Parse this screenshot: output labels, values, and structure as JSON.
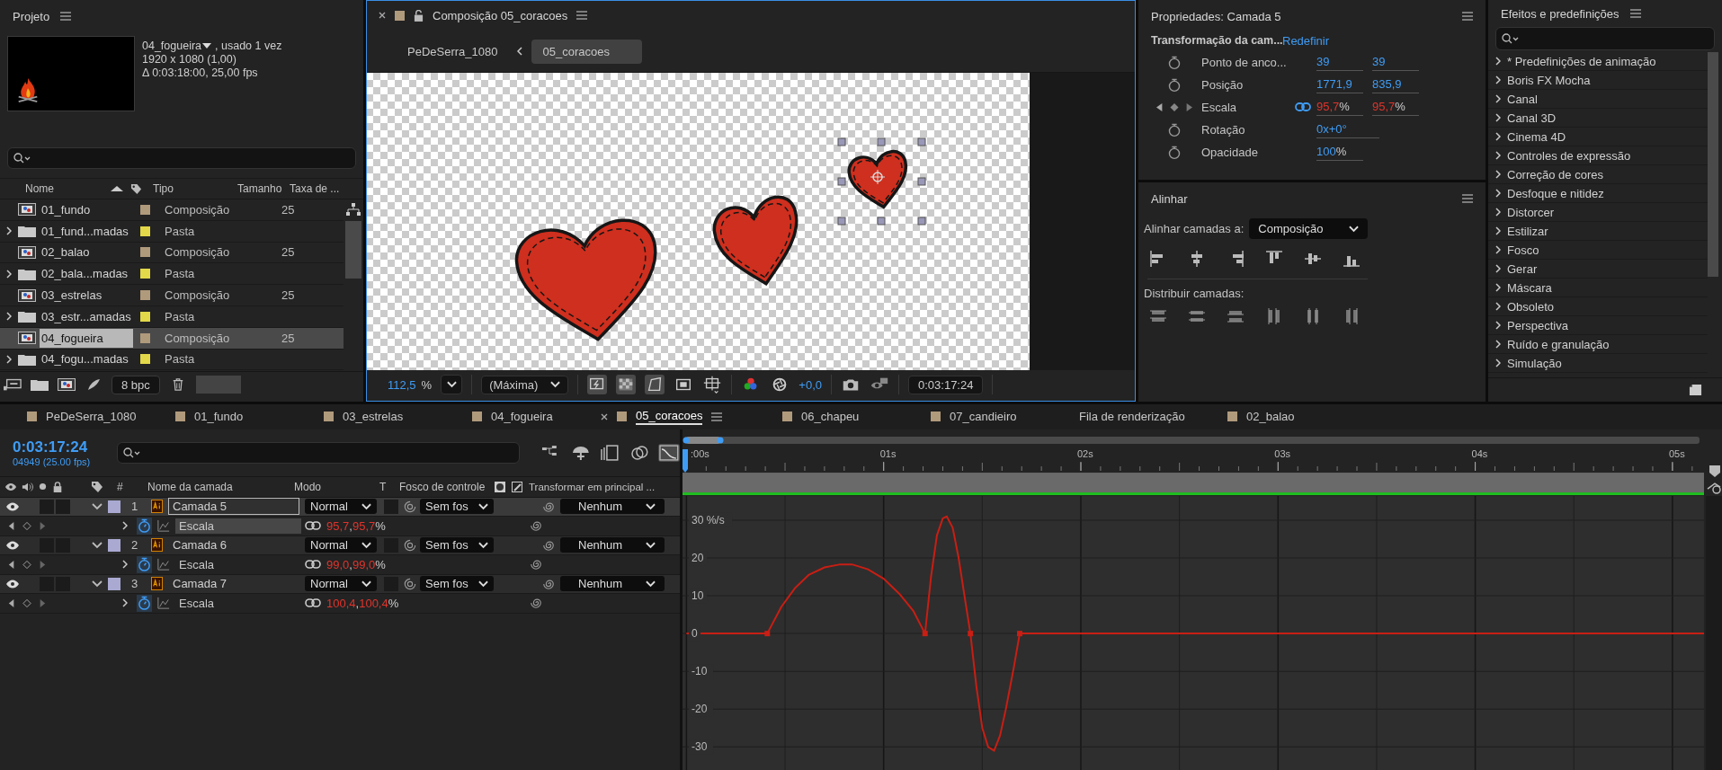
{
  "project": {
    "title": "Projeto",
    "preview": {
      "name": "04_fogueira",
      "usage": ", usado 1 vez",
      "resolution": "1920 x 1080 (1,00)",
      "duration": "Δ 0:03:18:00, 25,00 fps"
    },
    "columns": {
      "name": "Nome",
      "type": "Tipo",
      "size": "Tamanho",
      "rate": "Taxa de ..."
    },
    "items": [
      {
        "name": "01_fundo",
        "kind": "comp",
        "color": "#b09a7c",
        "type": "Composição",
        "rate": "25",
        "selected": false
      },
      {
        "name": "01_fund...madas",
        "kind": "folder",
        "color": "#e2d84a",
        "type": "Pasta",
        "selected": false
      },
      {
        "name": "02_balao",
        "kind": "comp",
        "color": "#b09a7c",
        "type": "Composição",
        "rate": "25",
        "selected": false
      },
      {
        "name": "02_bala...madas",
        "kind": "folder",
        "color": "#e2d84a",
        "type": "Pasta",
        "selected": false
      },
      {
        "name": "03_estrelas",
        "kind": "comp",
        "color": "#b09a7c",
        "type": "Composição",
        "rate": "25",
        "selected": false
      },
      {
        "name": "03_estr...amadas",
        "kind": "folder",
        "color": "#e2d84a",
        "type": "Pasta",
        "selected": false
      },
      {
        "name": "04_fogueira",
        "kind": "comp",
        "color": "#b09a7c",
        "type": "Composição",
        "rate": "25",
        "selected": true
      },
      {
        "name": "04_fogu...madas",
        "kind": "folder",
        "color": "#e2d84a",
        "type": "Pasta",
        "selected": false
      }
    ],
    "bpc": "8 bpc"
  },
  "composition": {
    "title": "Composição 05_coracoes",
    "color": "#b09a7c",
    "breadcrumbs": [
      {
        "label": "PeDeSerra_1080",
        "selected": false
      },
      {
        "label": "05_coracoes",
        "selected": true
      }
    ],
    "zoom": "112,5",
    "zoom_unit": "%",
    "resolution": "(Máxima)",
    "exposure": "+0,0",
    "timecode": "0:03:17:24"
  },
  "properties": {
    "title": "Propriedades: Camada 5",
    "section": "Transformação da cam...",
    "reset": "Redefinir",
    "rows": [
      {
        "label": "Ponto de anco...",
        "animated": false,
        "linked": false,
        "values": [
          {
            "value": "39"
          },
          {
            "value": "39"
          }
        ]
      },
      {
        "label": "Posição",
        "animated": false,
        "linked": false,
        "values": [
          {
            "value": "1771,9"
          },
          {
            "value": "835,9"
          }
        ]
      },
      {
        "label": "Escala",
        "animated": true,
        "linked": true,
        "values": [
          {
            "value": "95,7",
            "unit": "%"
          },
          {
            "value": "95,7",
            "unit": "%"
          }
        ]
      },
      {
        "label": "Rotação",
        "animated": false,
        "linked": false,
        "values": [
          {
            "value": "0x+0°"
          }
        ]
      },
      {
        "label": "Opacidade",
        "animated": false,
        "linked": false,
        "values": [
          {
            "value": "100",
            "unit": "%"
          }
        ]
      }
    ]
  },
  "align": {
    "title": "Alinhar",
    "target_label": "Alinhar camadas a:",
    "target": "Composição",
    "distribute_label": "Distribuir camadas:"
  },
  "effects": {
    "title": "Efeitos e predefinições",
    "items": [
      "* Predefinições de animação",
      "Boris FX Mocha",
      "Canal",
      "Canal 3D",
      "Cinema 4D",
      "Controles de expressão",
      "Correção de cores",
      "Desfoque e nitidez",
      "Distorcer",
      "Estilizar",
      "Fosco",
      "Gerar",
      "Máscara",
      "Obsoleto",
      "Perspectiva",
      "Ruído e granulação",
      "Simulação"
    ]
  },
  "timeline": {
    "tabs": [
      {
        "label": "PeDeSerra_1080",
        "color": "#b09a7c",
        "selected": false
      },
      {
        "label": "01_fundo",
        "color": "#b09a7c",
        "selected": false
      },
      {
        "label": "03_estrelas",
        "color": "#b09a7c",
        "selected": false
      },
      {
        "label": "04_fogueira",
        "color": "#b09a7c",
        "selected": false
      },
      {
        "label": "05_coracoes",
        "color": "#b09a7c",
        "selected": true
      },
      {
        "label": "06_chapeu",
        "color": "#b09a7c",
        "selected": false
      },
      {
        "label": "07_candieiro",
        "color": "#b09a7c",
        "selected": false
      },
      {
        "label": "Fila de renderização",
        "selected": false
      },
      {
        "label": "02_balao",
        "color": "#b09a7c",
        "selected": false
      }
    ],
    "timecode": "0:03:17:24",
    "frames": "04949 (25.00 fps)",
    "columns": {
      "number": "#",
      "name": "Nome da camada",
      "mode": "Modo",
      "t": "T",
      "matte": "Fosco de controle",
      "parent": "Transformar em principal ..."
    },
    "layers": [
      {
        "number": "1",
        "name": "Camada 5",
        "color": "#a9a9d2",
        "selected": true,
        "visible": true,
        "mode": "Normal",
        "matte": "Sem fos",
        "parent": "Nenhum",
        "property": {
          "name": "Escala",
          "selected": true,
          "values": [
            "95,7",
            "95,7"
          ],
          "separator": ",",
          "unit": "%"
        }
      },
      {
        "number": "2",
        "name": "Camada 6",
        "color": "#a9a9d2",
        "selected": false,
        "visible": true,
        "mode": "Normal",
        "matte": "Sem fos",
        "parent": "Nenhum",
        "property": {
          "name": "Escala",
          "selected": false,
          "values": [
            "99,0",
            "99,0"
          ],
          "separator": ",",
          "unit": "%"
        }
      },
      {
        "number": "3",
        "name": "Camada 7",
        "color": "#a9a9d2",
        "selected": false,
        "visible": true,
        "mode": "Normal",
        "matte": "Sem fos",
        "parent": "Nenhum",
        "property": {
          "name": "Escala",
          "selected": false,
          "values": [
            "100,4",
            "100,4"
          ],
          "separator": ",",
          "unit": "%"
        }
      }
    ],
    "graph": {
      "chart_data": {
        "type": "line",
        "xlim": [
          -0.02,
          5.16
        ],
        "ylim": [
          -36.2,
          36.4
        ],
        "grid": true,
        "xticks": [
          {
            "value": 0,
            "label": ":00s"
          },
          {
            "value": 1,
            "label": "01s"
          },
          {
            "value": 2,
            "label": "02s"
          },
          {
            "value": 3,
            "label": "03s"
          },
          {
            "value": 4,
            "label": "04s"
          },
          {
            "value": 5,
            "label": "05s"
          }
        ],
        "yticks": [
          {
            "value": 30,
            "label": "30 %/s"
          },
          {
            "value": 20,
            "label": "20"
          },
          {
            "value": 10,
            "label": "10"
          },
          {
            "value": 0,
            "label": "0"
          },
          {
            "value": -10,
            "label": "-10"
          },
          {
            "value": -20,
            "label": "-20"
          },
          {
            "value": -30,
            "label": "-30"
          }
        ],
        "x": [
          0,
          0.41,
          0.48,
          0.55,
          0.62,
          0.7,
          0.78,
          0.84,
          0.92,
          1.0,
          1.08,
          1.15,
          1.21,
          1.24,
          1.27,
          1.3,
          1.32,
          1.35,
          1.38,
          1.41,
          1.44,
          1.47,
          1.5,
          1.53,
          1.56,
          1.59,
          1.62,
          1.66,
          1.69,
          5.16
        ],
        "series": [
          {
            "color": "#c81e14",
            "values": [
              0,
              0,
              7,
              12,
              15.5,
              17.5,
              18.3,
              18.3,
              17,
              14.5,
              10.5,
              6,
              0,
              15,
              26,
              30.5,
              31,
              28,
              20,
              10,
              0,
              -14,
              -25,
              -30,
              -31,
              -27,
              -20,
              -9,
              0,
              0
            ]
          }
        ]
      }
    }
  }
}
